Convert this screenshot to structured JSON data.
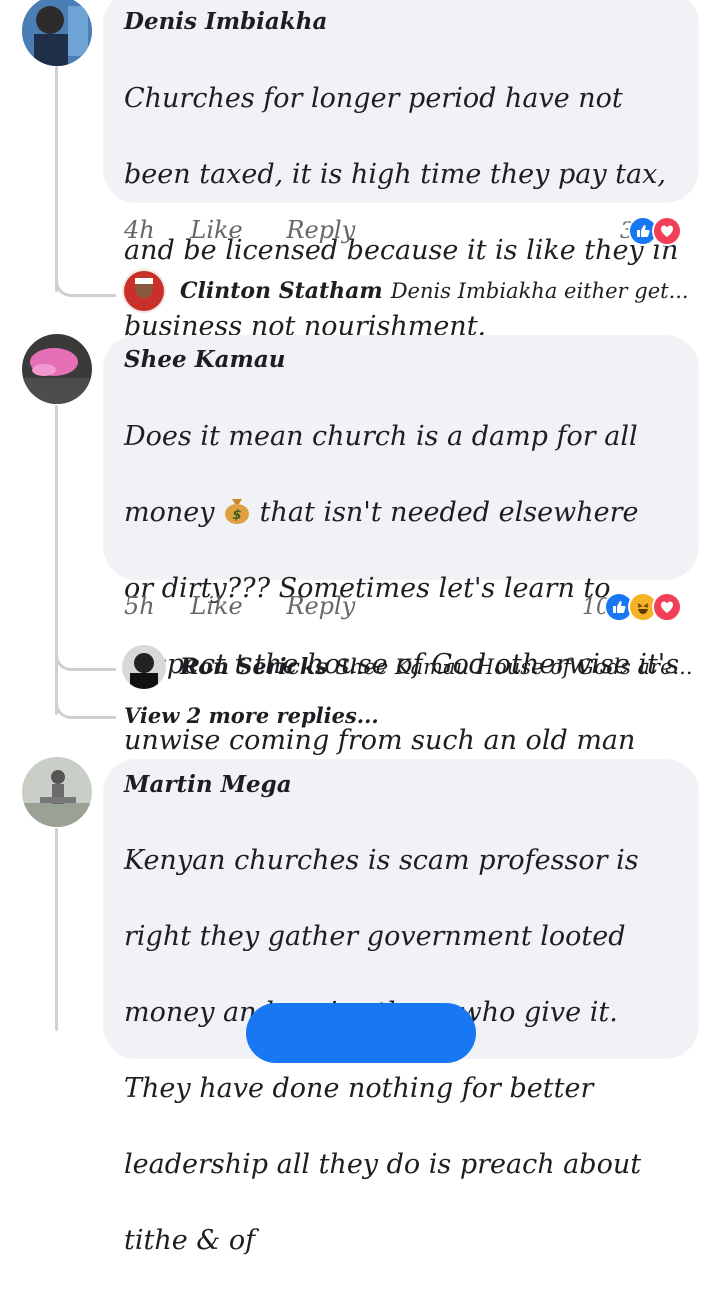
{
  "comments": [
    {
      "author": "Denis Imbiakha",
      "lines": [
        "Churches for longer period  have not",
        "been taxed, it is high time they pay tax,",
        "and be licensed because it is like they in",
        "business not nourishment."
      ],
      "time": "4h",
      "like_label": "Like",
      "reply_label": "Reply",
      "reaction_count": "3",
      "reactions": [
        "like",
        "love"
      ],
      "replies": [
        {
          "author": "Clinton Statham",
          "snippet": "Denis Imbiakha either get..."
        }
      ]
    },
    {
      "author": "Shee Kamau",
      "line1_before": "Does it mean church is a damp for all",
      "line2_before": "money",
      "line2_after": "that isn't needed elsewhere",
      "lines_rest": [
        "or dirty??? Sometimes let's learn to",
        "respect t the house of God otherwise it's",
        "unwise coming from such an old man"
      ],
      "time": "5h",
      "like_label": "Like",
      "reply_label": "Reply",
      "reaction_count": "10",
      "reactions": [
        "like",
        "haha",
        "love"
      ],
      "emoji": "money-bag",
      "replies": [
        {
          "author": "Ron Sericks",
          "snippet": "Shee Kamau House of Gods are..."
        }
      ],
      "view_more": "View 2 more replies..."
    },
    {
      "author": "Martin Mega",
      "lines": [
        "Kenyan churches is scam professor is",
        "right they gather government looted",
        "money and praise those who give it.",
        "They have done nothing for better",
        "leadership all they do is preach about",
        "tithe & of"
      ]
    }
  ],
  "colors": {
    "bubble": "#f0f2f5",
    "thread": "#ced0d4",
    "like": "#1877f2",
    "love": "#f33e58",
    "haha": "#f7b125",
    "meta": "#65676b"
  }
}
